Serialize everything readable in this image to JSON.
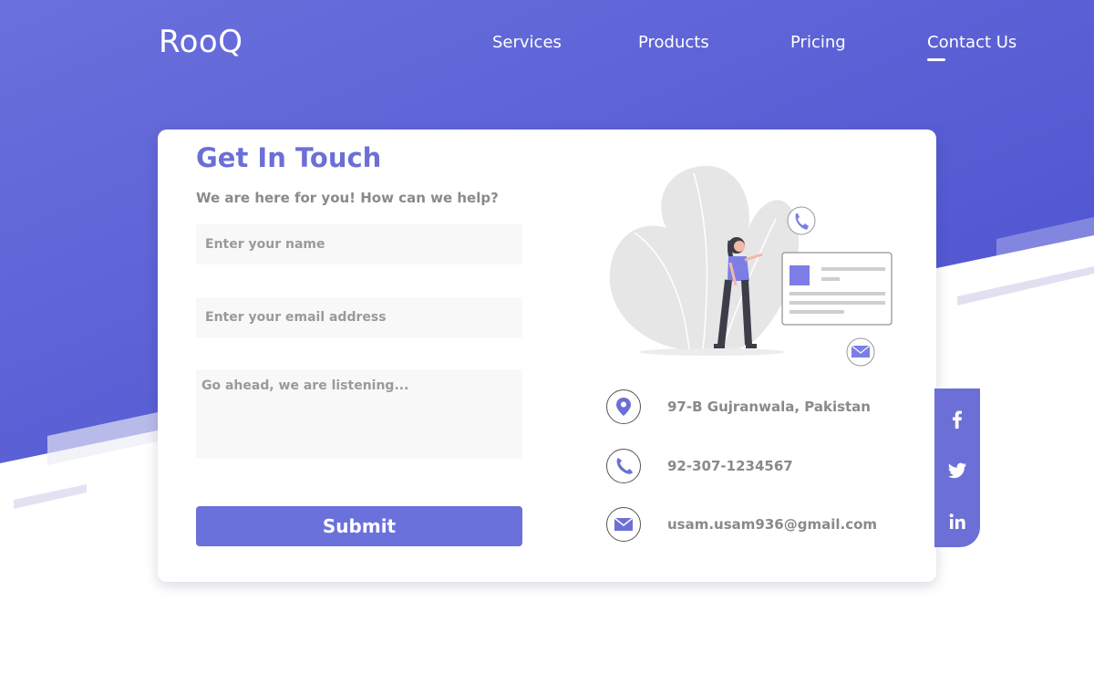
{
  "header": {
    "logo": "RooQ",
    "nav": [
      {
        "label": "Services"
      },
      {
        "label": "Products"
      },
      {
        "label": "Pricing"
      },
      {
        "label": "Contact Us",
        "active": true
      }
    ]
  },
  "contact_form": {
    "title": "Get In Touch",
    "subtitle": "We are here for you! How can we help?",
    "name_placeholder": "Enter your name",
    "email_placeholder": "Enter your email address",
    "message_placeholder": "Go ahead, we are listening...",
    "submit_label": "Submit"
  },
  "contact_info": [
    {
      "icon": "location-pin-icon",
      "text": "97-B Gujranwala, Pakistan"
    },
    {
      "icon": "phone-icon",
      "text": "92-307-1234567"
    },
    {
      "icon": "envelope-icon",
      "text": "usam.usam936@gmail.com"
    }
  ],
  "social": [
    "facebook-icon",
    "twitter-icon",
    "linkedin-icon"
  ],
  "colors": {
    "accent": "#6b6fd6",
    "gradient_start": "#6a70dc",
    "gradient_end": "#4b4fce",
    "text_muted": "#8a8a8a",
    "field_bg": "#f8f8f8"
  }
}
